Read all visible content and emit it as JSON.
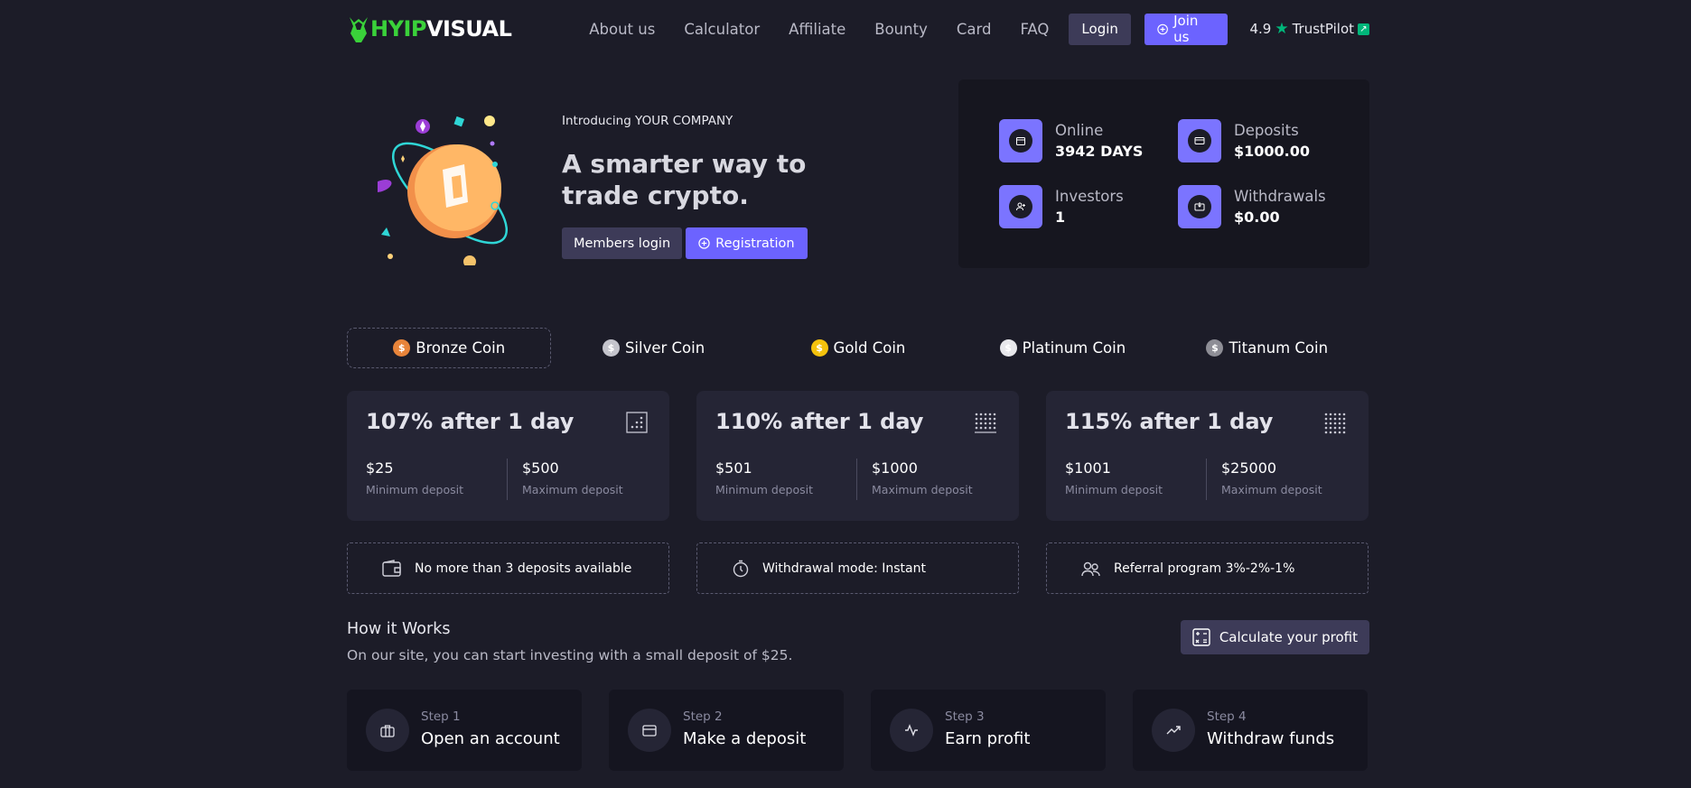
{
  "header": {
    "logo_part1": "HYIP",
    "logo_part2": "VISUAL",
    "nav": [
      "About us",
      "Calculator",
      "Affiliate",
      "Bounty",
      "Card",
      "FAQ"
    ],
    "login_label": "Login",
    "join_label": "Join us",
    "trust_rating": "4.9",
    "trust_name": "TrustPilot"
  },
  "hero": {
    "intro": "Introducing YOUR COMPANY",
    "title": "A smarter way to trade crypto.",
    "members_login": "Members login",
    "registration": "Registration"
  },
  "stats": {
    "online_label": "Online",
    "online_value": "3942 DAYS",
    "deposits_label": "Deposits",
    "deposits_value": "$1000.00",
    "investors_label": "Investors",
    "investors_value": "1",
    "withdrawals_label": "Withdrawals",
    "withdrawals_value": "$0.00"
  },
  "coin_tabs": [
    {
      "label": "Bronze Coin",
      "color": "#e8843a"
    },
    {
      "label": "Silver Coin",
      "color": "#c4c4cc"
    },
    {
      "label": "Gold Coin",
      "color": "#f4c20d"
    },
    {
      "label": "Platinum Coin",
      "color": "#e8e8ec"
    },
    {
      "label": "Titanum Coin",
      "color": "#8e8e96"
    }
  ],
  "plans": [
    {
      "title": "107% after 1 day",
      "min": "$25",
      "max": "$500",
      "min_label": "Minimum deposit",
      "max_label": "Maximum deposit"
    },
    {
      "title": "110% after 1 day",
      "min": "$501",
      "max": "$1000",
      "min_label": "Minimum deposit",
      "max_label": "Maximum deposit"
    },
    {
      "title": "115% after 1 day",
      "min": "$1001",
      "max": "$25000",
      "min_label": "Minimum deposit",
      "max_label": "Maximum deposit"
    }
  ],
  "infos": [
    "No more than 3 deposits available",
    "Withdrawal mode: Instant",
    "Referral program 3%-2%-1%"
  ],
  "how": {
    "title": "How it Works",
    "subtitle": "On our site, you can start investing with a small deposit of $25.",
    "calc_button": "Calculate your profit"
  },
  "steps": [
    {
      "num": "Step 1",
      "name": "Open an account"
    },
    {
      "num": "Step 2",
      "name": "Make a deposit"
    },
    {
      "num": "Step 3",
      "name": "Earn profit"
    },
    {
      "num": "Step 4",
      "name": "Withdraw funds"
    }
  ],
  "colors": {
    "accent": "#6c63ff",
    "background": "#1c1c28",
    "card": "#252535",
    "trustpilot": "#00b67a",
    "logo_green": "#3ad13a"
  }
}
